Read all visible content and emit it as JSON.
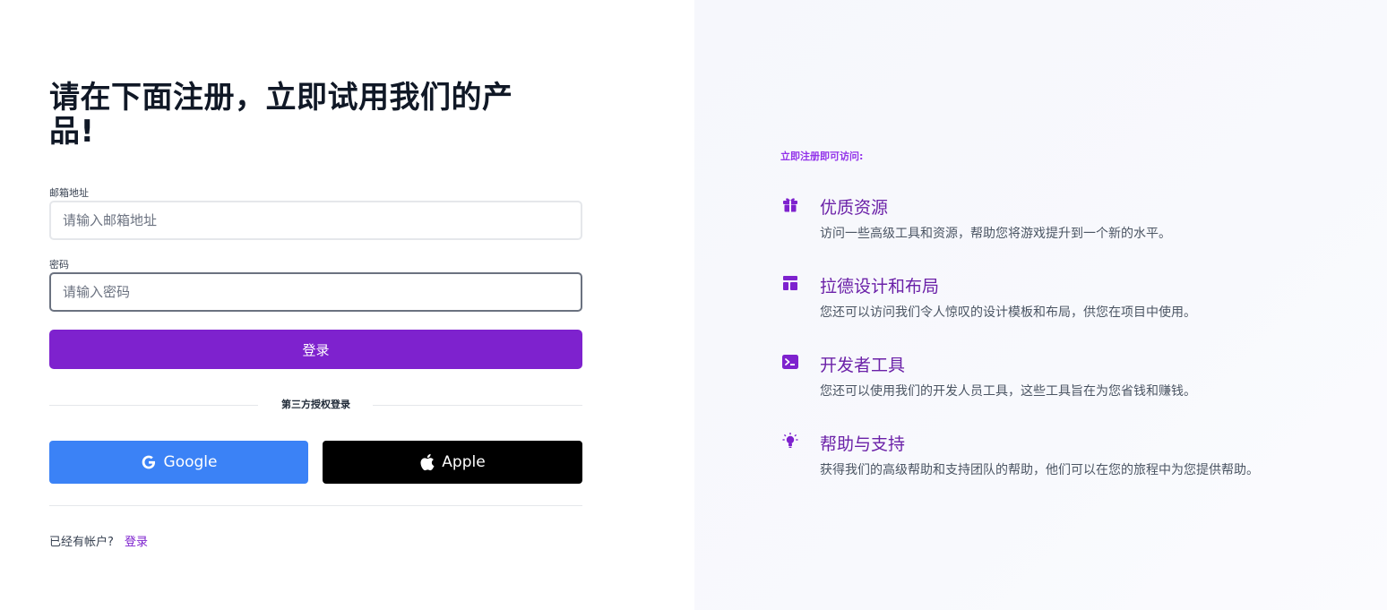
{
  "form": {
    "title": "请在下面注册，立即试用我们的产品!",
    "email_label": "邮箱地址",
    "email_placeholder": "请输入邮箱地址",
    "email_value": "",
    "password_label": "密码",
    "password_placeholder": "请输入密码",
    "password_value": "",
    "submit_label": "登录",
    "divider_text": "第三方授权登录",
    "google_label": "Google",
    "apple_label": "Apple",
    "account_prompt": "已经有帐户?",
    "login_link": "登录"
  },
  "access": {
    "title": "立即注册即可访问:",
    "features": [
      {
        "icon": "gift-icon",
        "title": "优质资源",
        "desc": "访问一些高级工具和资源，帮助您将游戏提升到一个新的水平。"
      },
      {
        "icon": "layout-icon",
        "title": "拉德设计和布局",
        "desc": "您还可以访问我们令人惊叹的设计模板和布局，供您在项目中使用。"
      },
      {
        "icon": "terminal-icon",
        "title": "开发者工具",
        "desc": "您还可以使用我们的开发人员工具，这些工具旨在为您省钱和赚钱。"
      },
      {
        "icon": "lightbulb-icon",
        "title": "帮助与支持",
        "desc": "获得我们的高级帮助和支持团队的帮助，他们可以在您的旅程中为您提供帮助。"
      }
    ]
  },
  "colors": {
    "accent": "#7e22ce",
    "google": "#3b82f6",
    "apple": "#000000",
    "feature_title": "#6b21a8"
  }
}
